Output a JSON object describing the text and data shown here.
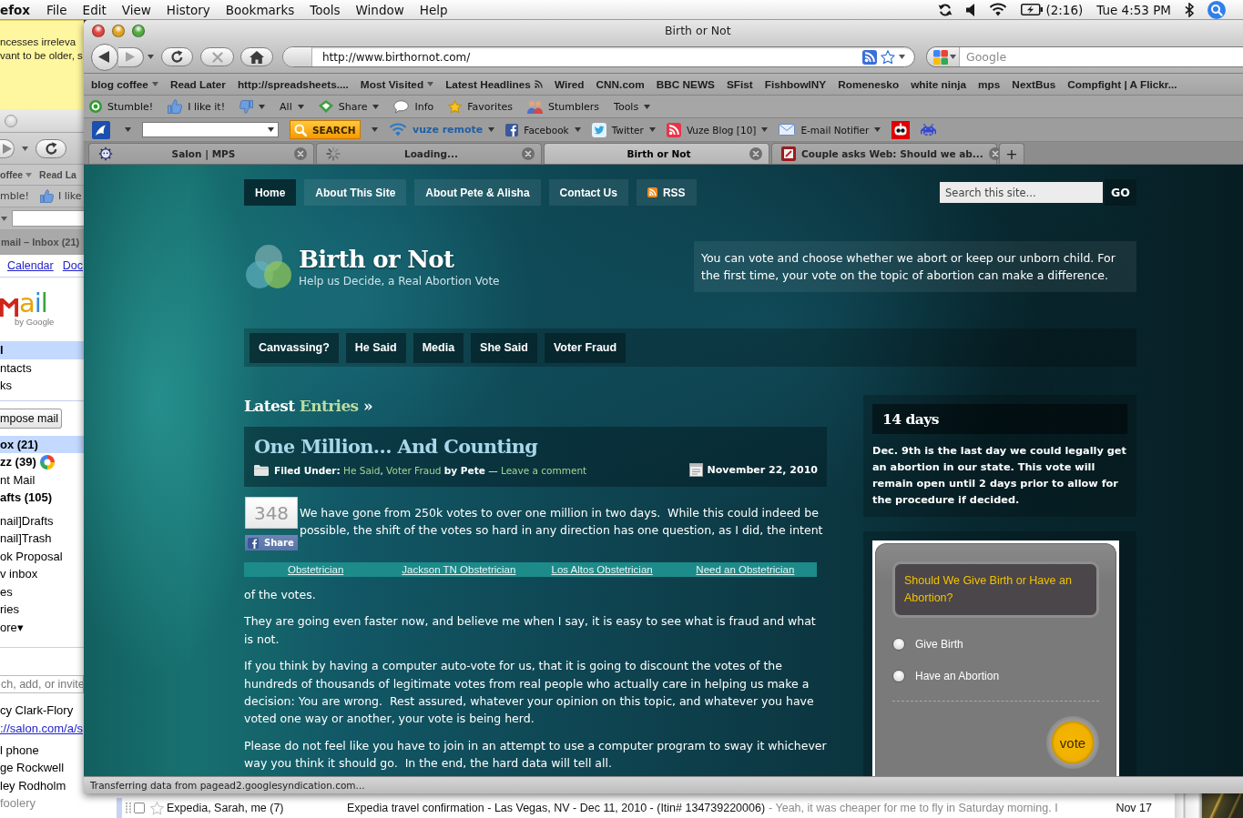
{
  "menu_bar": {
    "app_name": "efox",
    "menus": [
      "File",
      "Edit",
      "View",
      "History",
      "Bookmarks",
      "Tools",
      "Window",
      "Help"
    ],
    "battery_time": "(2:16)",
    "clock": "Tue 4:53 PM"
  },
  "sticky_note": {
    "lines": [
      "ncesses irreleva",
      "vant to be older, s"
    ]
  },
  "background_browser": {
    "bookmarks": [
      {
        "label": "offee",
        "kind": "folder"
      },
      {
        "label": "Read La",
        "kind": "link"
      }
    ],
    "stumble_items": [
      {
        "label": "mble!",
        "kind": "text"
      },
      {
        "label": "I like",
        "kind": "like"
      }
    ],
    "tab_title": "mail – Inbox (21)"
  },
  "gmail": {
    "top_links": [
      "Calendar",
      "Doc"
    ],
    "logo": {
      "text": "ail",
      "byline": "by Google"
    },
    "nav": [
      {
        "label": "l",
        "selected": true
      },
      {
        "label": "ntacts",
        "selected": false
      },
      {
        "label": "ks",
        "selected": false
      }
    ],
    "compose_button": "mpose mail",
    "system_labels": [
      {
        "label": "ox (21)",
        "selected": true,
        "unread": true,
        "has_icon": false
      },
      {
        "label": "zz (39)",
        "selected": false,
        "unread": true,
        "has_icon": true
      },
      {
        "label": "nt Mail",
        "selected": false,
        "unread": false,
        "has_icon": false
      },
      {
        "label": "afts (105)",
        "selected": false,
        "unread": true,
        "has_icon": false
      }
    ],
    "user_labels": [
      "nail]Drafts",
      "nail]Trash",
      "ok Proposal",
      "v inbox",
      "es",
      "ries"
    ],
    "more": "ore▾",
    "chat_search": {
      "placeholder": "ch, add, or invite"
    },
    "contacts": [
      {
        "text": "cy Clark-Flory",
        "kind": "name"
      },
      {
        "text": "://salon.com/a/s",
        "kind": "link"
      },
      {
        "text": "l phone",
        "kind": "name"
      },
      {
        "text": "ge Rockwell",
        "kind": "name"
      },
      {
        "text": "ley Rodholm",
        "kind": "name"
      },
      {
        "text": "foolery",
        "kind": "status"
      }
    ],
    "message": {
      "checked": false,
      "starred": false,
      "sender": "Expedia, Sarah, me (7)",
      "subject": "Expedia travel confirmation - Las Vegas, NV - Dec 11, 2010 - (Itin# 134739220006)",
      "snippet": "- Yeah, it was cheaper for me to fly in Saturday morning. I",
      "date": "Nov 17"
    }
  },
  "firefox": {
    "title": "Birth or Not",
    "history_buttons": [
      {
        "kind": "back",
        "disabled": false
      },
      {
        "kind": "forward",
        "disabled": true
      }
    ],
    "nav_buttons": [
      {
        "kind": "reload",
        "disabled": false
      },
      {
        "kind": "stop",
        "disabled": true
      },
      {
        "kind": "home",
        "disabled": false
      }
    ],
    "url": "http://www.birthornot.com/",
    "search": {
      "placeholder": "Google"
    },
    "bookmarks": [
      {
        "label": "blog coffee",
        "kind": "folder"
      },
      {
        "label": "Read Later",
        "kind": "link"
      },
      {
        "label": "http://spreadsheets....",
        "kind": "link"
      },
      {
        "label": "Most Visited",
        "kind": "folder"
      },
      {
        "label": "Latest Headlines",
        "kind": "feed"
      },
      {
        "label": "Wired",
        "kind": "link"
      },
      {
        "label": "CNN.com",
        "kind": "link"
      },
      {
        "label": "BBC NEWS",
        "kind": "link"
      },
      {
        "label": "SFist",
        "kind": "link"
      },
      {
        "label": "FishbowlNY",
        "kind": "link"
      },
      {
        "label": "Romenesko",
        "kind": "link"
      },
      {
        "label": "white ninja",
        "kind": "link"
      },
      {
        "label": "mps",
        "kind": "link"
      },
      {
        "label": "NextBus",
        "kind": "link"
      },
      {
        "label": "Compfight | A Flickr...",
        "kind": "link"
      }
    ],
    "stumble_toolbar": [
      {
        "kind": "stumble",
        "label": "Stumble!",
        "dropdown": false
      },
      {
        "kind": "like",
        "label": "I like it!",
        "dropdown": false
      },
      {
        "kind": "dislike",
        "dropdown": true
      },
      {
        "kind": "all",
        "label": "All",
        "dropdown": true
      },
      {
        "kind": "share",
        "label": "Share",
        "dropdown": true
      },
      {
        "kind": "info",
        "label": "Info",
        "dropdown": false
      },
      {
        "kind": "favorites",
        "label": "Favorites",
        "dropdown": false
      },
      {
        "kind": "stumblers",
        "label": "Stumblers",
        "dropdown": false
      },
      {
        "kind": "tools",
        "label": "Tools",
        "dropdown": true
      }
    ],
    "addon_toolbar": [
      {
        "kind": "app",
        "dropdown": true
      },
      {
        "kind": "search-box"
      },
      {
        "kind": "search-button",
        "label": "SEARCH",
        "dropdown": true
      },
      {
        "kind": "remote",
        "label": "vuze remote",
        "dropdown": true
      },
      {
        "kind": "facebook",
        "label": "Facebook",
        "dropdown": true
      },
      {
        "kind": "twitter",
        "label": "Twitter",
        "dropdown": true
      },
      {
        "kind": "feed",
        "label": "Vuze Blog [10]",
        "dropdown": true
      },
      {
        "kind": "mail",
        "label": "E-mail Notifier",
        "dropdown": true
      },
      {
        "kind": "robot"
      },
      {
        "kind": "invader"
      }
    ],
    "tabs": [
      {
        "title": "Salon | MPS",
        "kind": "gear",
        "selected": false
      },
      {
        "title": "Loading...",
        "kind": "loading",
        "selected": false
      },
      {
        "title": "Birth or Not",
        "kind": "plain",
        "selected": true
      },
      {
        "title": "Couple asks Web: Should we ab...",
        "kind": "tile",
        "selected": false
      }
    ],
    "new_tab": "+",
    "status": "Transferring data from pagead2.googlesyndication.com..."
  },
  "site": {
    "nav": [
      {
        "label": "Home",
        "selected": true,
        "kind": "page"
      },
      {
        "label": "About This Site",
        "selected": false,
        "kind": "page"
      },
      {
        "label": "About Pete & Alisha",
        "selected": false,
        "kind": "page"
      },
      {
        "label": "Contact Us",
        "selected": false,
        "kind": "page"
      },
      {
        "label": "RSS",
        "selected": false,
        "kind": "feed"
      }
    ],
    "search": {
      "placeholder": "Search this site...",
      "button": "GO"
    },
    "title": "Birth or Not",
    "tagline": "Help us Decide, a Real Abortion Vote",
    "intro": "You can vote and choose whether we abort or keep our unborn child. For the first time, your vote on the topic of abortion can make a difference.",
    "categories": [
      "Canvassing?",
      "He Said",
      "Media",
      "She Said",
      "Voter Fraud"
    ],
    "section_heading": {
      "lead": "Latest",
      "highlight": "Entries",
      "suffix": "»"
    },
    "post": {
      "title": "One Million… And Counting",
      "filed_label": "Filed Under:",
      "categories": [
        "He Said",
        "Voter Fraud"
      ],
      "category_separator": ",",
      "byline": "by Pete",
      "dash": "—",
      "comment_link": "Leave a comment",
      "date": "November 22, 2010",
      "share": {
        "count": "348",
        "label": "Share"
      },
      "lead": "We have gone from 250k votes to over one million in two days.  While this could indeed be possible, the shift of the votes so hard in any direction has one question, as I did, the intent",
      "ad_links": [
        "Obstetrician",
        "Jackson TN Obstetrician",
        "Los Altos Obstetrician",
        "Need an Obstetrician"
      ],
      "paragraphs": [
        "of the votes.",
        "They are going even faster now, and believe me when I say, it is easy to see what is fraud and what is not.",
        "If you think by having a computer auto-vote for us, that it is going to discount the votes of the hundreds of thousands of legitimate votes from real people who actually care in helping us make a decision: You are wrong.  Rest assured, whatever your opinion on this topic, and whatever you have voted one way or another, your vote is being herd.",
        "Please do not feel like you have to join in an attempt to use a computer program to sway it whichever way you think it should go.  In the end, the hard data will tell all."
      ]
    },
    "countdown": {
      "title": "14 days",
      "text": "Dec. 9th is the last day we could legally get an abortion in our state. This vote will remain open until 2 days prior to allow for the procedure if decided."
    },
    "poll": {
      "question": "Should We Give Birth or Have an Abortion?",
      "options": [
        {
          "label": "Give Birth",
          "selected": false
        },
        {
          "label": "Have an Abortion",
          "selected": false
        }
      ],
      "button": "vote"
    }
  }
}
